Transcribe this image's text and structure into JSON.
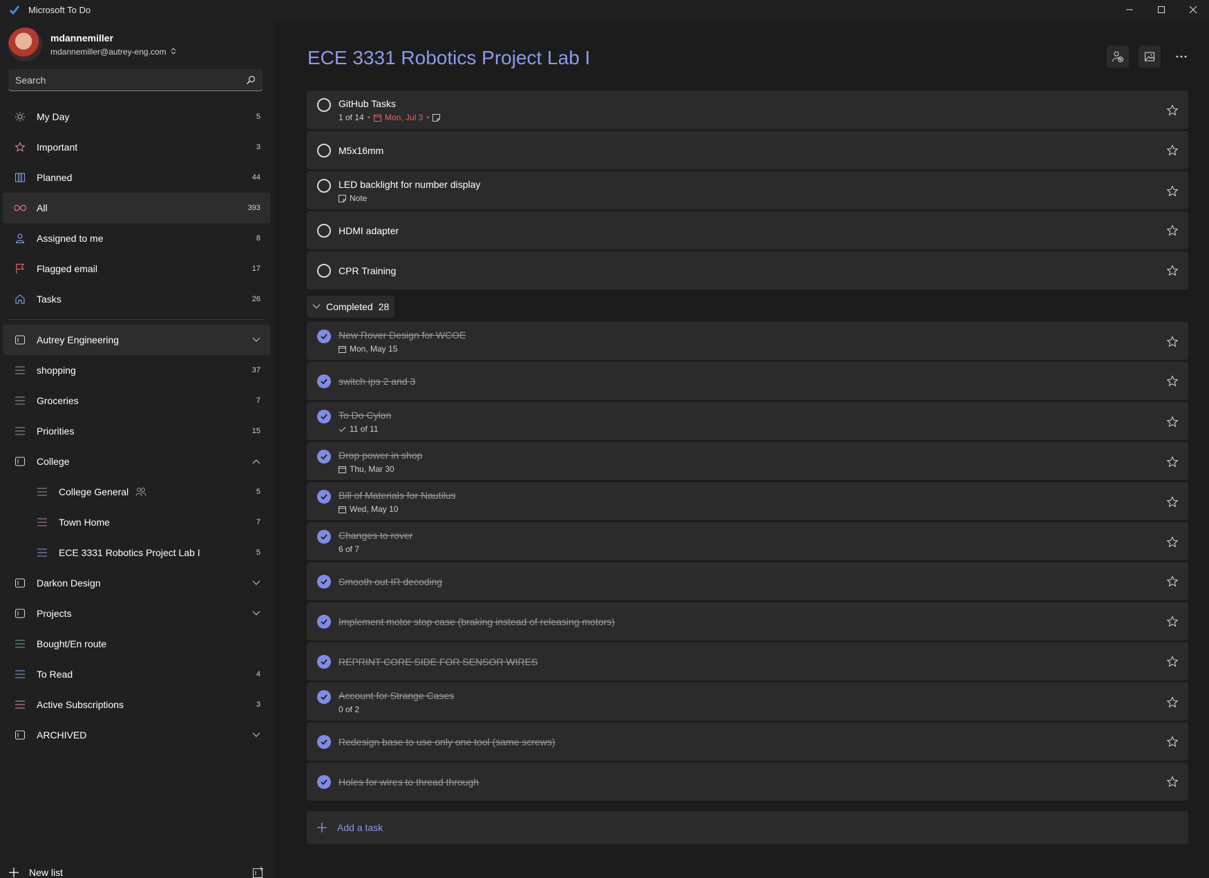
{
  "window": {
    "title": "Microsoft To Do"
  },
  "account": {
    "name": "mdannemiller",
    "email": "mdannemiller@autrey-eng.com"
  },
  "search": {
    "placeholder": "Search"
  },
  "nav": {
    "smart_lists": [
      {
        "label": "My Day",
        "count": "5",
        "icon": "sun-icon"
      },
      {
        "label": "Important",
        "count": "3",
        "icon": "star-icon"
      },
      {
        "label": "Planned",
        "count": "44",
        "icon": "calendar-grid-icon"
      },
      {
        "label": "All",
        "count": "393",
        "icon": "infinity-icon"
      },
      {
        "label": "Assigned to me",
        "count": "8",
        "icon": "person-icon"
      },
      {
        "label": "Flagged email",
        "count": "17",
        "icon": "flag-icon"
      },
      {
        "label": "Tasks",
        "count": "26",
        "icon": "home-icon"
      }
    ],
    "lists": [
      {
        "label": "Autrey Engineering",
        "count": "",
        "type": "group"
      },
      {
        "label": "shopping",
        "count": "37",
        "type": "list"
      },
      {
        "label": "Groceries",
        "count": "7",
        "type": "list"
      },
      {
        "label": "Priorities",
        "count": "15",
        "type": "list"
      },
      {
        "label": "College",
        "count": "",
        "type": "group-open"
      },
      {
        "label": "College General",
        "count": "5",
        "type": "sublist"
      },
      {
        "label": "Town Home",
        "count": "7",
        "type": "sublist"
      },
      {
        "label": "ECE 3331 Robotics Project Lab I",
        "count": "5",
        "type": "sublist"
      },
      {
        "label": "Darkon Design",
        "count": "",
        "type": "group"
      },
      {
        "label": "Projects",
        "count": "",
        "type": "group"
      },
      {
        "label": "Bought/En route",
        "count": "",
        "type": "list"
      },
      {
        "label": "To Read",
        "count": "4",
        "type": "list"
      },
      {
        "label": "Active Subscriptions",
        "count": "3",
        "type": "list"
      },
      {
        "label": "ARCHIVED",
        "count": "",
        "type": "group"
      }
    ],
    "new_list_label": "New list"
  },
  "main": {
    "title": "ECE 3331 Robotics Project Lab I",
    "open_tasks": [
      {
        "title": "GitHub Tasks",
        "steps": "1 of 14",
        "due": "Mon, Jul 3"
      },
      {
        "title": "M5x16mm"
      },
      {
        "title": "LED backlight for number display",
        "note": "Note"
      },
      {
        "title": "HDMI adapter"
      },
      {
        "title": "CPR Training"
      }
    ],
    "completed": {
      "label": "Completed",
      "count": "28"
    },
    "completed_tasks": [
      {
        "title": "New Rover Design for WCOE",
        "due": "Mon, May 15"
      },
      {
        "title": "switch ips 2 and 3"
      },
      {
        "title": "To Do Cylon",
        "steps": "11 of 11"
      },
      {
        "title": "Drop power in shop",
        "due": "Thu, Mar 30"
      },
      {
        "title": "Bill of Materials for Nautilus",
        "due": "Wed, May 10"
      },
      {
        "title": "Changes to rover",
        "steps_plain": "6 of 7"
      },
      {
        "title": "Smooth out IR decoding"
      },
      {
        "title": "Implement motor stop case (braking instead of releasing motors)"
      },
      {
        "title": "REPRINT CORE SIDE FOR SENSOR WIRES"
      },
      {
        "title": "Account for Strange Cases",
        "steps_plain": "0 of 2"
      },
      {
        "title": "Redesign base to use only one tool (same screws)"
      },
      {
        "title": "Holes for wires to thread through"
      }
    ],
    "add_task_label": "Add a task"
  },
  "colors": {
    "accent": "#8c9aec",
    "check": "#7f8ce6",
    "due_red": "#e36666",
    "flag": "#e36666"
  }
}
